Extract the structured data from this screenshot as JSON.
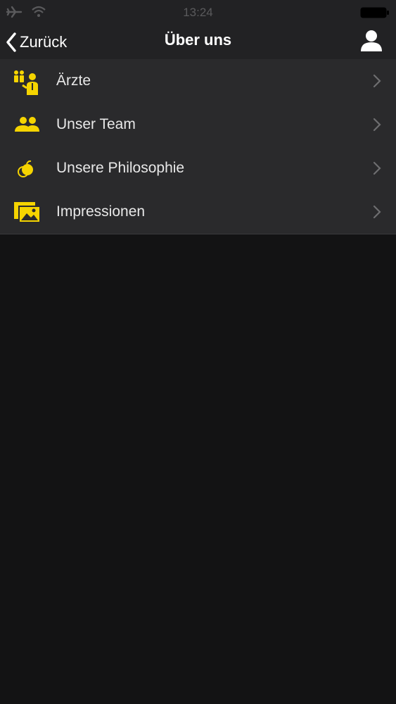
{
  "status_bar": {
    "time": "13:24",
    "icons": [
      "airplane-icon",
      "wifi-icon",
      "battery-icon"
    ]
  },
  "nav": {
    "back_label": "Zurück",
    "title": "Über uns",
    "right_icon": "user-icon"
  },
  "menu": {
    "items": [
      {
        "label": "Ärzte",
        "icon": "doctors-icon"
      },
      {
        "label": "Unser Team",
        "icon": "team-icon"
      },
      {
        "label": "Unsere Philosophie",
        "icon": "philosophy-icon"
      },
      {
        "label": "Impressionen",
        "icon": "photos-icon"
      }
    ]
  },
  "colors": {
    "accent": "#f5d400",
    "bar_background": "#222224",
    "list_background": "#2a2a2c",
    "page_background": "#131314",
    "chevron": "#6e6e70"
  }
}
